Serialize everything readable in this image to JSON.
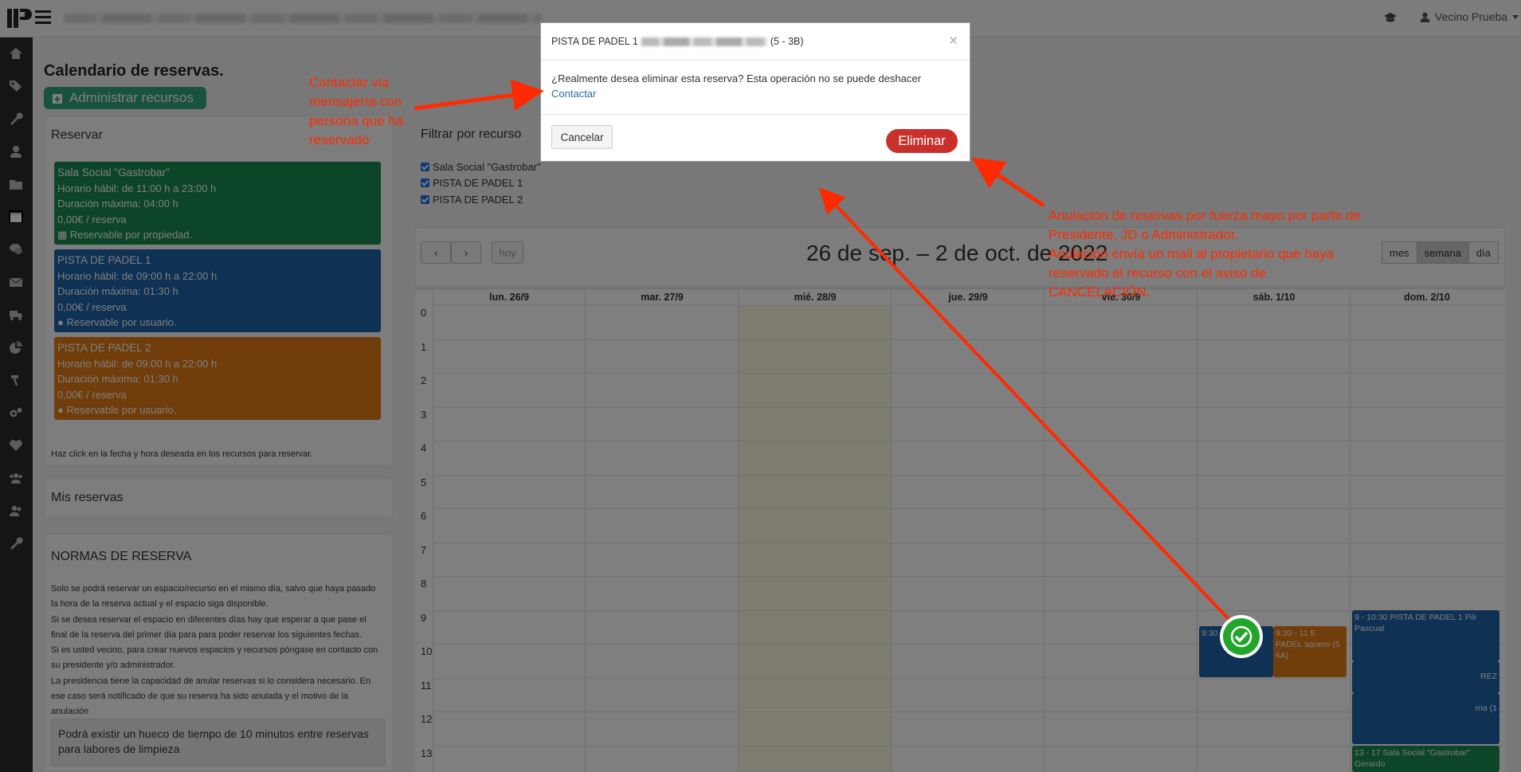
{
  "topbar": {
    "user": "Vecino Prueba"
  },
  "page": {
    "title": "Calendario de reservas.",
    "admin_button": "Administrar recursos"
  },
  "reservar": {
    "title": "Reservar",
    "resources": [
      {
        "name": "Sala Social \"Gastrobar\"",
        "hours_label": "Horario hábil: de",
        "open": "11:00 h",
        "to": "a",
        "close": "23:00 h",
        "duration_label": "Duración máxima:",
        "duration": "04:00 h",
        "price": "0,00€",
        "price_unit": "/ reserva",
        "mode": "Reservable por propiedad.",
        "color": "#1a8a52"
      },
      {
        "name": "PISTA DE PADEL 1",
        "hours_label": "Horario hábil: de",
        "open": "09:00 h",
        "to": "a",
        "close": "22:00 h",
        "duration_label": "Duración máxima:",
        "duration": "01:30 h",
        "price": "0,00€",
        "price_unit": "/ reserva",
        "mode": "Reservable por usuario.",
        "color": "#1e63a8"
      },
      {
        "name": "PISTA DE PADEL 2",
        "hours_label": "Horario hábil: de",
        "open": "09:00 h",
        "to": "a",
        "close": "22:00 h",
        "duration_label": "Duración máxima:",
        "duration": "01:30 h",
        "price": "0,00€",
        "price_unit": "/ reserva",
        "mode": "Reservable por usuario.",
        "color": "#e07b16"
      }
    ],
    "hint": "Haz click en la fecha y hora deseada en los recursos para reservar."
  },
  "mis_reservas": {
    "title": "Mis reservas"
  },
  "normas": {
    "title": "NORMAS DE RESERVA",
    "lines": [
      "Solo se podrá reservar un espacio/recurso en el mismo día, salvo que haya pasado",
      "la hora de la reserva actual y el espacio siga disponible.",
      "Si se desea reservar el espacio en diferentes días hay que esperar a que pase el",
      "final de la reserva del primer día para para poder reservar los siguientes fechas.",
      "Si es usted vecino, para crear nuevos espacios y recursos póngase en contacto con",
      "su presidente y/o administrador.",
      "La presidencia tiene la capacidad de anular reservas si lo considera necesario. En",
      "ese caso será notificado de que su reserva ha sido anulada y el motivo de la",
      "anulación"
    ],
    "box": "Podrá existir un hueco de tiempo de 10 minutos entre reservas para labores de limpieza"
  },
  "filter": {
    "title": "Filtrar por recurso",
    "items": [
      "Sala Social \"Gastrobar\"",
      "PISTA DE PADEL 1",
      "PISTA DE PADEL 2"
    ]
  },
  "calendar": {
    "today": "hoy",
    "range": "26 de sep. – 2 de oct. de 2022",
    "views": [
      "mes",
      "semana",
      "día"
    ],
    "days": [
      "lun. 26/9",
      "mar. 27/9",
      "mié. 28/9",
      "jue. 29/9",
      "vie. 30/9",
      "sáb. 1/10",
      "dom. 2/10"
    ],
    "hours": [
      "0",
      "1",
      "2",
      "3",
      "4",
      "5",
      "6",
      "7",
      "8",
      "9",
      "10",
      "11",
      "12",
      "13"
    ],
    "events": [
      {
        "text": "9:30 Pi G",
        "color": "#1e63a8"
      },
      {
        "text": "9:30 - 11 E PADEL squero (5 6A)",
        "color": "#e07b16"
      },
      {
        "text": "9 - 10:30 PISTA DE PADEL 1 Pili Pascual",
        "color": "#1e63a8"
      },
      {
        "text": "REZ",
        "color": "#1e63a8"
      },
      {
        "text": "rna (1",
        "color": "#1e63a8"
      },
      {
        "text": "13 - 17 Sala Social \"Gastrobar\" Gerardo",
        "color": "#1a8a52"
      }
    ]
  },
  "modal": {
    "title_prefix": "PISTA DE PADEL 1",
    "title_suffix": "(5 - 3B)",
    "close": "×",
    "message": "¿Realmente desea eliminar esta reserva? Esta operación no se puede deshacer",
    "contact": "Contactar",
    "cancel": "Cancelar",
    "delete": "Eliminar"
  },
  "annotations": {
    "contact_note": [
      "Contactar via",
      "mensajería con",
      "persona que ha",
      "reservado"
    ],
    "cancel_note": [
      "Anulación de reservas por fuerza mayo por parte de",
      "Presidente, JD o Administrador.",
      "Anulación envía un mail al propietario que haya",
      "reservado el recurso con el aviso de",
      "CANCELACIÓN."
    ],
    "color": "#ff2a00"
  }
}
